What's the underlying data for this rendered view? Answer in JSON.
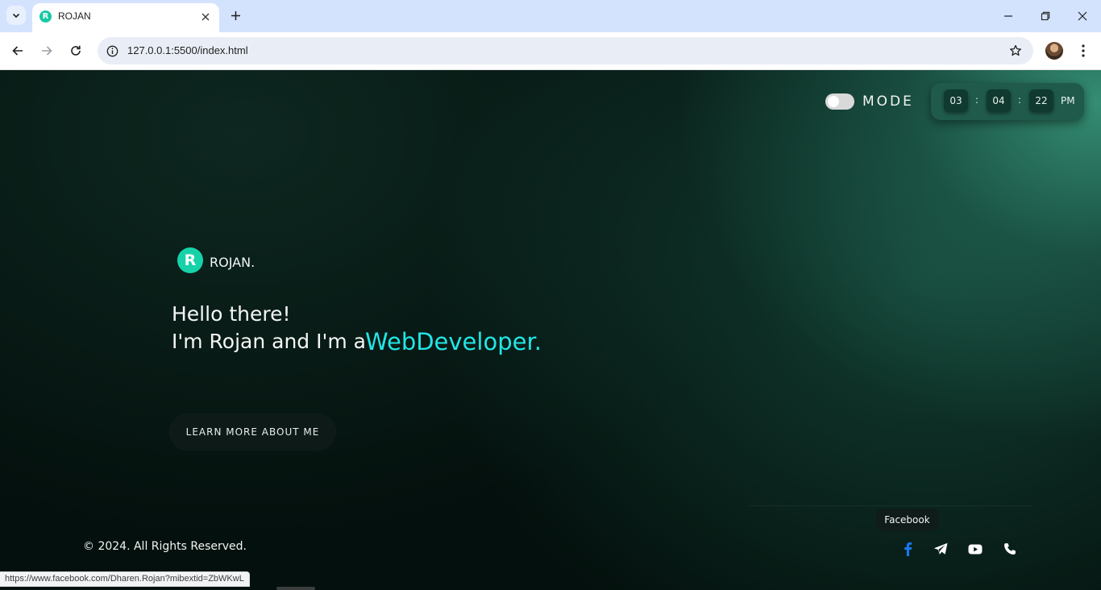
{
  "browser": {
    "tab_title": "ROJAN",
    "tab_favicon_letter": "R",
    "url": "127.0.0.1:5500/index.html",
    "status_link": "https://www.facebook.com/Dharen.Rojan?mibextid=ZbWKwL"
  },
  "header": {
    "mode_label": "MODE",
    "clock": {
      "hours": "03",
      "minutes": "04",
      "seconds": "22",
      "separator": ":",
      "ampm": "PM"
    }
  },
  "brand": {
    "logo_letter": "R",
    "name": "ROJAN."
  },
  "hero": {
    "line1": "Hello there!",
    "line2": "I'm Rojan and I'm a",
    "role": "WebDeveloper.",
    "cta_label": "LEARN MORE ABOUT ME"
  },
  "footer": {
    "copyright": "© 2024. All Rights Reserved.",
    "tooltip": "Facebook",
    "social_icons": [
      "facebook-icon",
      "telegram-icon",
      "youtube-icon",
      "phone-icon"
    ]
  },
  "colors": {
    "accent_cyan": "#22e6e6",
    "logo_teal": "#17d2a8",
    "facebook_blue": "#1877f2"
  }
}
